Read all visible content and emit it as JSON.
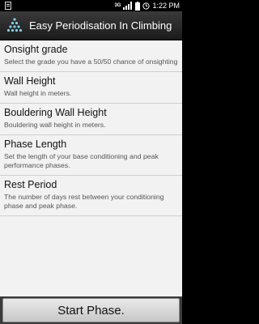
{
  "status_bar": {
    "network": "3G",
    "time": "1:22 PM",
    "icons": [
      "notification-icon",
      "signal-icon",
      "battery-icon",
      "alarm-icon"
    ]
  },
  "app_bar": {
    "title": "Easy Periodisation In Climbing",
    "icon": "app-logo-icon"
  },
  "settings": [
    {
      "title": "Onsight grade",
      "description": "Select the grade you have a 50/50 chance of onsighting"
    },
    {
      "title": "Wall Height",
      "description": "Wall height in meters."
    },
    {
      "title": "Bouldering Wall Height",
      "description": "Bouldering wall height in meters."
    },
    {
      "title": "Phase Length",
      "description": "Set the length of your base conditioning and peak performance phases."
    },
    {
      "title": "Rest Period",
      "description": "The number of days rest between your conditioning phase and peak phase."
    }
  ],
  "footer": {
    "start_label": "Start Phase."
  }
}
